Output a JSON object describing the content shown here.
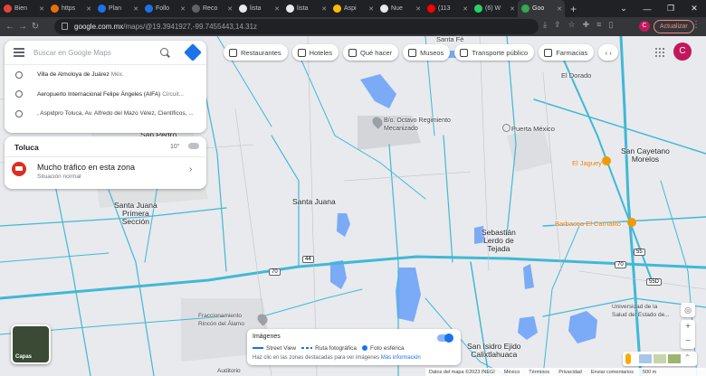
{
  "browser": {
    "tabs": [
      {
        "label": "Bien",
        "color": "#ea4335",
        "active": false
      },
      {
        "label": "https",
        "color": "#e8710a",
        "active": false
      },
      {
        "label": "Plan",
        "color": "#1a73e8",
        "active": false
      },
      {
        "label": "Follo",
        "color": "#1a73e8",
        "active": false
      },
      {
        "label": "Reco",
        "color": "#5f6368",
        "active": false
      },
      {
        "label": "lista",
        "color": "#e8eaed",
        "active": false
      },
      {
        "label": "lista",
        "color": "#e8eaed",
        "active": false
      },
      {
        "label": "Aspi",
        "color": "#fbbc04",
        "active": false
      },
      {
        "label": "Nue",
        "color": "#e8eaed",
        "active": false
      },
      {
        "label": "(113",
        "color": "#ff0000",
        "active": false
      },
      {
        "label": "(6) W",
        "color": "#25d366",
        "active": false
      },
      {
        "label": "Goo",
        "color": "#34a853",
        "active": true
      }
    ],
    "url_host": "google.com.mx",
    "url_path": "/maps/@19.3941927,-99.7455443,14.31z",
    "update_label": "Actualizar",
    "avatar_letter": "C"
  },
  "search": {
    "placeholder": "Buscar en Google Maps",
    "history": [
      {
        "main": "Villa de Almoloya de Juárez",
        "sub": "Méx."
      },
      {
        "main": "Aeropuerto Internacional Felipe Ángeles (AIFA)",
        "sub": "Circuit..."
      },
      {
        "main": ", Aspidpro Toluca, Av. Alfredo del Mazo Vélez, Científicos, ...",
        "sub": ""
      }
    ]
  },
  "traffic": {
    "city": "Toluca",
    "temp": "10°",
    "title": "Mucho tráfico en esta zona",
    "subtitle": "Situación normal"
  },
  "chips": [
    {
      "label": "Restaurantes",
      "icon": "fork-knife-icon"
    },
    {
      "label": "Hoteles",
      "icon": "bed-icon"
    },
    {
      "label": "Qué hacer",
      "icon": "camera-icon"
    },
    {
      "label": "Museos",
      "icon": "museum-icon"
    },
    {
      "label": "Transporte público",
      "icon": "bus-icon"
    },
    {
      "label": "Farmacias",
      "icon": "pharmacy-icon"
    }
  ],
  "account_letter": "C",
  "map_labels": {
    "el_dorado": "El Dorado",
    "santa_fe": "Santa Fé",
    "octavo": "B/o. Octavo Regimiento\nMecanizado",
    "puerta_mexico": "Puerta México",
    "san_pedro": "San Pedro",
    "san_cayetano": "San Cayetano\nMorelos",
    "el_jaguey": "El Jaguey",
    "santa_juana": "Santa Juana",
    "santa_juana_pr": "Santa Juana\nPrimera\nSección",
    "sebastian": "Sebastián\nLerdo de\nTejada",
    "barbacoa": "Barbacoa El Carnalito",
    "fracc": "Fraccionamiento\nRincón del Álamo",
    "san_isidro": "San Isidro Ejido\nCalixtlahuaca",
    "universidad": "Universidad de la\nSalud del Estado de...",
    "auditorio": "Auditorio",
    "route_70a": "70",
    "route_70b": "70",
    "route_55": "55",
    "route_55d": "55D",
    "route_44": "44"
  },
  "layers_label": "Capas",
  "imagery": {
    "title": "Imágenes",
    "street_view": "Street View",
    "photo_route": "Ruta fotográfica",
    "sphere": "Foto esférica",
    "footer_text": "Haz clic en las zonas destacadas para ver imágenes",
    "more_link": "Más información"
  },
  "footer": {
    "data": "Datos del mapa ©2023 INEGI",
    "country": "México",
    "terms": "Términos",
    "privacy": "Privacidad",
    "feedback": "Enviar comentarios",
    "scale": "500 m"
  },
  "colors": {
    "road": "#41b8d5",
    "water": "#7baaf7",
    "accent": "#1a73e8"
  }
}
